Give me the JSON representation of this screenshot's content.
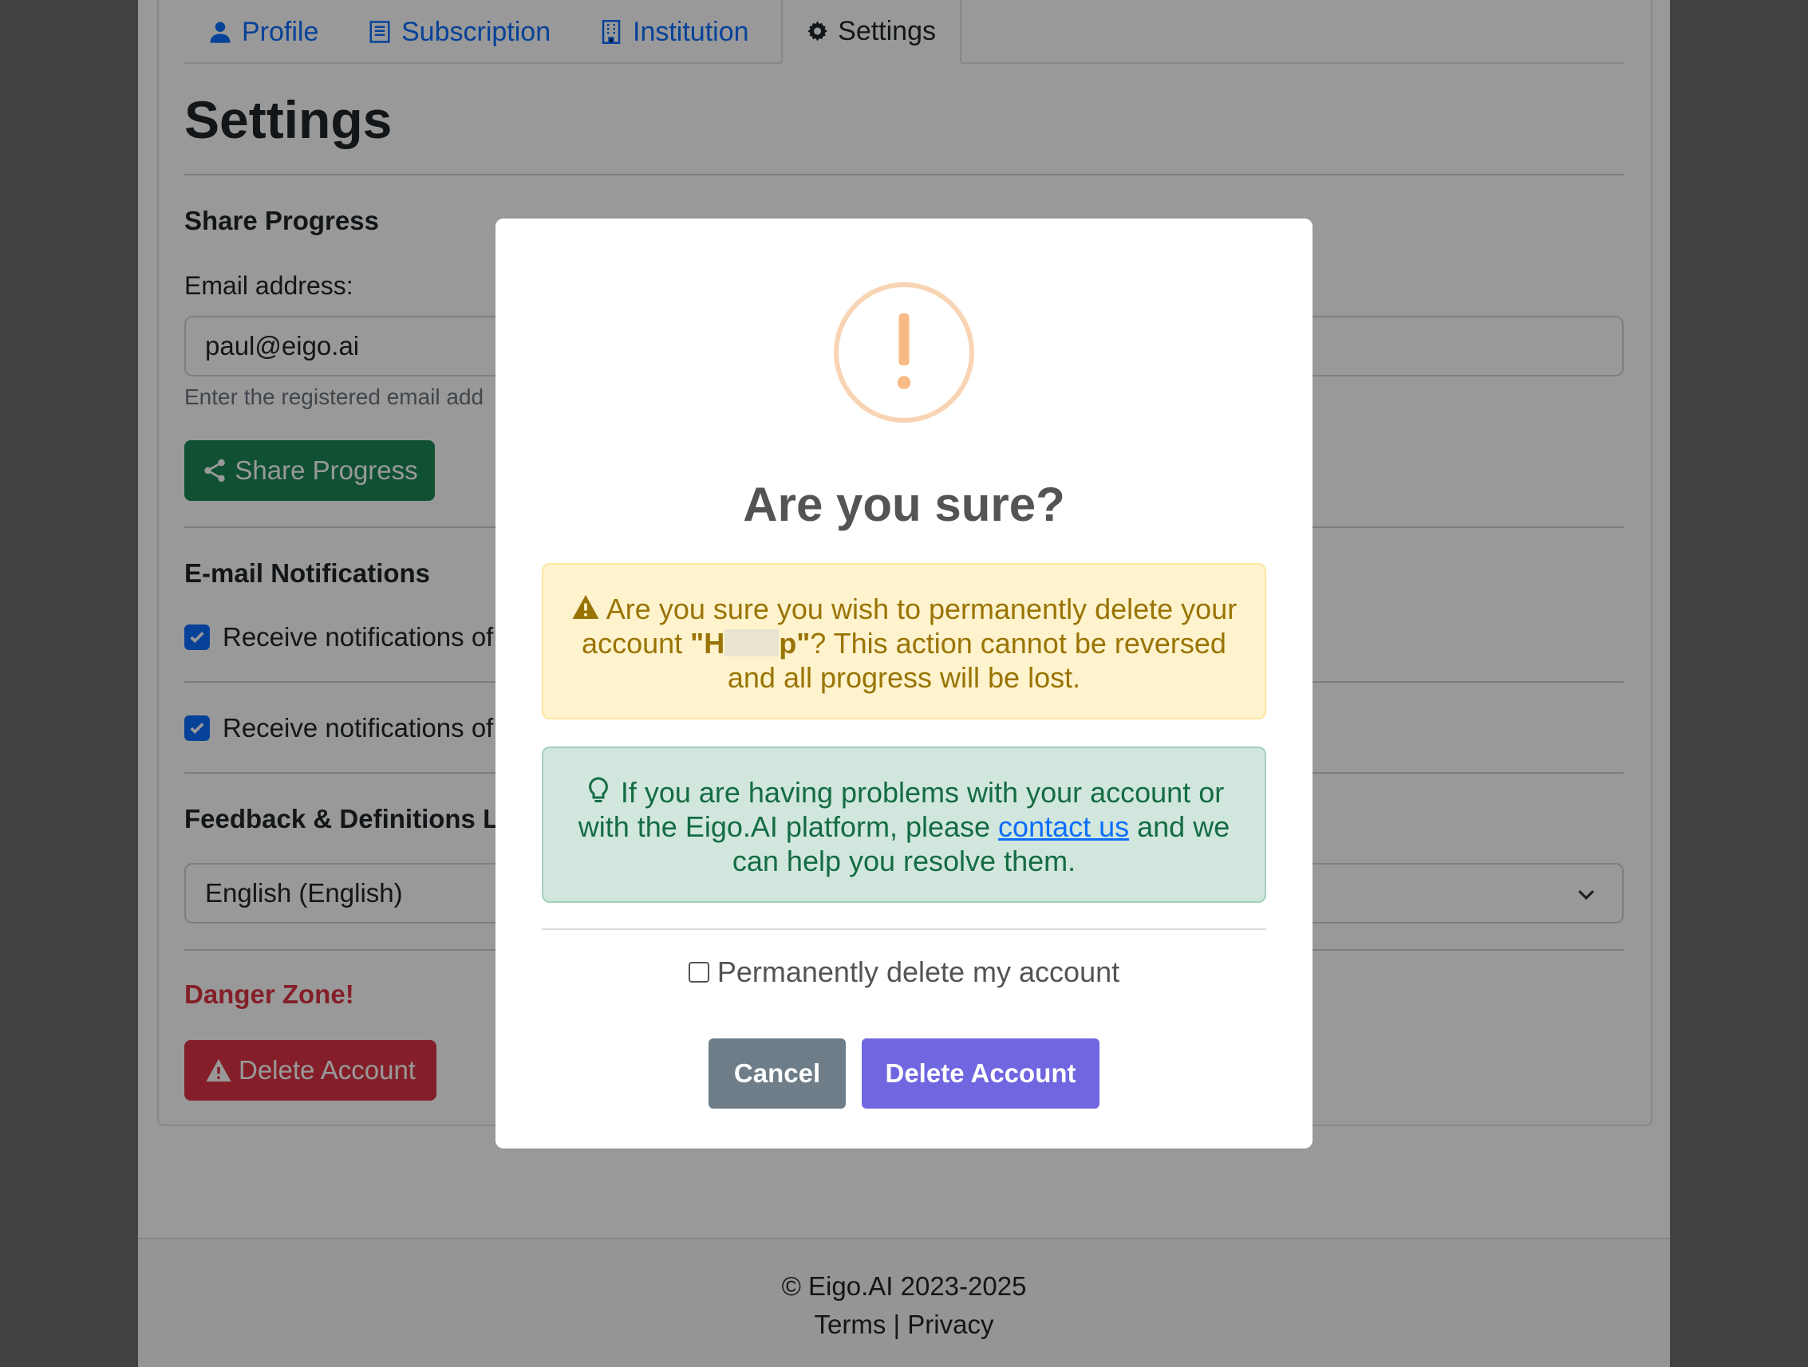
{
  "tabs": [
    {
      "label": "Profile",
      "icon": "person-icon"
    },
    {
      "label": "Subscription",
      "icon": "receipt-icon"
    },
    {
      "label": "Institution",
      "icon": "building-icon"
    },
    {
      "label": "Settings",
      "icon": "gear-icon"
    }
  ],
  "page": {
    "title": "Settings",
    "share_section": "Share Progress",
    "email_label": "Email address:",
    "email_value": "paul@eigo.ai",
    "email_help": "Enter the registered email add",
    "share_button": "Share Progress",
    "notifications_section": "E-mail Notifications",
    "notif_1": "Receive notifications of",
    "notif_2": "Receive notifications of",
    "feedback_section": "Feedback & Definitions La",
    "language_value": "English (English)",
    "danger_title": "Danger Zone!",
    "delete_button": "Delete Account"
  },
  "footer": {
    "copyright": "© Eigo.AI 2023-2025",
    "terms": "Terms",
    "separator": "|",
    "privacy": "Privacy"
  },
  "modal": {
    "title": "Are you sure?",
    "warning_pre": "Are you sure you wish to permanently delete your account ",
    "warning_name_start": "\"H",
    "warning_name_end": "p\"",
    "warning_post": "? This action cannot be reversed and all progress will be lost.",
    "info_pre": "If you are having problems with your account or with the Eigo.AI platform, please ",
    "info_link": "contact us",
    "info_post": " and we can help you resolve them.",
    "checkbox_label": "Permanently delete my account",
    "cancel_button": "Cancel",
    "confirm_button": "Delete Account"
  },
  "colors": {
    "link": "#0d6efd",
    "success": "#198754",
    "danger": "#dc3545",
    "confirm": "#7066e0",
    "cancel": "#6e7d88"
  }
}
